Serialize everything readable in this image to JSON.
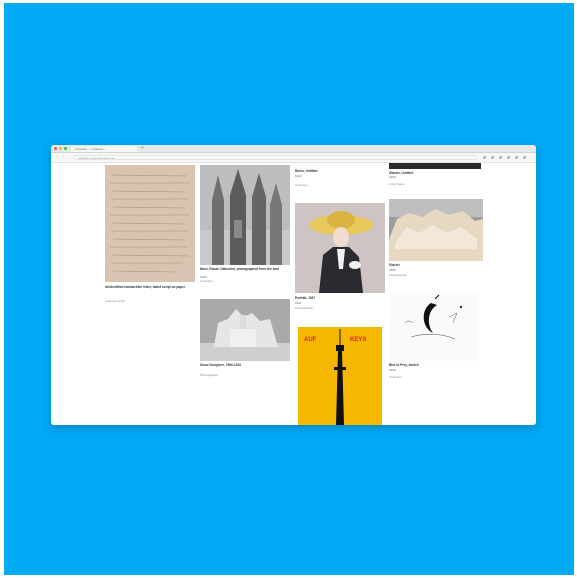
{
  "browser": {
    "tab_title": "Artworks — Collection",
    "new_tab": "+",
    "back": "‹",
    "forward": "›",
    "address": "collection.example/artworks"
  },
  "colors": {
    "backdrop": "#00aaf5",
    "poster_yellow": "#f5b700",
    "poster_red": "#d7261e",
    "ink": "#111111"
  },
  "artworks": [
    {
      "title": "Unidentified handwritten letter, faded script on paper",
      "date": "",
      "artist": "Unknown artist",
      "image": "old handwritten letter"
    },
    {
      "title": "Nave, Rouen Cathedral, photographed from the east",
      "date": "1906",
      "artist": "Unknown",
      "image": "gothic cathedral photograph"
    },
    {
      "title": "Snow Sculpture, 1906-1910",
      "date": "",
      "artist": "Photographer",
      "image": "snow sculpture photograph"
    },
    {
      "title": "Ruins, Untitled",
      "date": "1922",
      "artist": "Unknown",
      "image": "portrait caption"
    },
    {
      "title": "Portrait, 1937",
      "date": "1937",
      "artist": "Photographer",
      "image": "woman with wide-brimmed hat"
    },
    {
      "poster_left": "AUF",
      "poster_right": "KEYS",
      "image": "poster with black tower"
    },
    {
      "title": "Glacier, Untitled",
      "date": "1999",
      "artist": "Artist Name",
      "image": "top strip"
    },
    {
      "title": "Glacier",
      "date": "1895",
      "artist": "Photographer",
      "image": "glacier landscape"
    },
    {
      "title": "Bird of Prey, sketch",
      "date": "1930",
      "artist": "Unknown",
      "image": "ink sketch of crescent"
    }
  ]
}
